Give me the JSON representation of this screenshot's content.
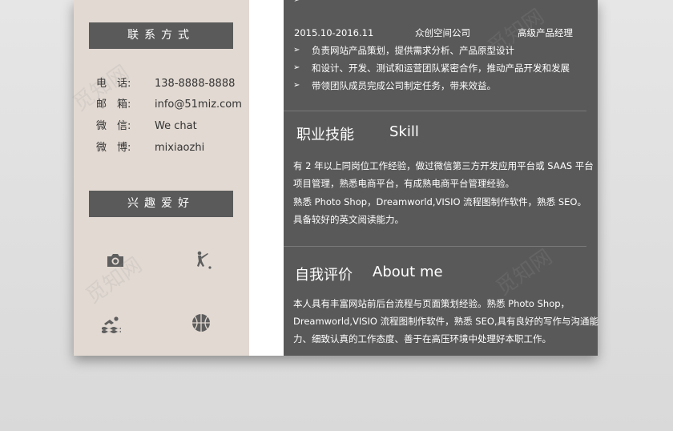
{
  "contact": {
    "title": "联系方式",
    "items": [
      {
        "label": "电　话:",
        "value": "138-8888-8888"
      },
      {
        "label": "邮　箱:",
        "value": "info@51miz.com"
      },
      {
        "label": "微　信:",
        "value": "We chat"
      },
      {
        "label": "微　博:",
        "value": "mixiaozhi"
      }
    ]
  },
  "hobbies": {
    "title": "兴趣爱好",
    "icons": [
      "camera-icon",
      "golf-icon",
      "swimming-icon",
      "basketball-icon"
    ]
  },
  "experience": {
    "period": "2015.10-2016.11",
    "company": "众创空间公司",
    "position": "高级产品经理",
    "bullets": [
      "负责网站产品策划，提供需求分析、产品原型设计",
      "和设计、开发、测试和运营团队紧密合作，推动产品开发和发展",
      "带领团队成员完成公司制定任务，带来效益。"
    ]
  },
  "skills": {
    "title_cn": "职业技能",
    "title_en": "Skill",
    "lines": [
      "有 2 年以上同岗位工作经验，做过微信第三方开发应用平台或 SAAS 平台",
      "项目管理，熟悉电商平台，有成熟电商平台管理经验。",
      "熟悉 Photo Shop，Dreamworld,VISIO 流程图制作软件，熟悉 SEO。",
      "具备较好的英文阅读能力。"
    ]
  },
  "about": {
    "title_cn": "自我评价",
    "title_en": "About me",
    "lines": [
      "本人具有丰富网站前后台流程与页面策划经验。熟悉 Photo Shop，",
      "Dreamworld,VISIO 流程图制作软件，熟悉 SEO,具有良好的写作与沟通能",
      "力、细致认真的工作态度、善于在高压环境中处理好本职工作。"
    ]
  },
  "watermark": "觅知网"
}
